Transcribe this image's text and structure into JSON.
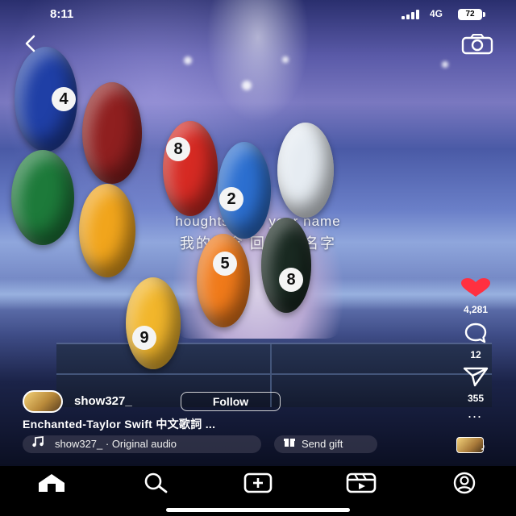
{
  "status_bar": {
    "time": "8:11",
    "network": "4G",
    "battery": "72"
  },
  "icons": {
    "back": "back-chevron-icon",
    "camera": "camera-icon",
    "like": "heart-icon",
    "comment": "comment-bubble-icon",
    "share": "send-icon",
    "more": "more-dots-icon",
    "audio": "music-note-icon",
    "gift": "gift-icon",
    "home": "home-icon",
    "search": "search-icon",
    "create": "create-plus-icon",
    "reels": "reels-icon",
    "profile": "profile-icon"
  },
  "video": {
    "lyric_en": "houghts    a  ho your name",
    "lyric_zh": "我的思念    回    你的名字"
  },
  "balls": [
    {
      "number": "4",
      "color": "#1f3fa6"
    },
    {
      "number": "",
      "color": "#8f1f1f"
    },
    {
      "number": "",
      "color": "#1d7a3a"
    },
    {
      "number": "",
      "color": "#f1a51c"
    },
    {
      "number": "8",
      "color": "#d62a23"
    },
    {
      "number": "2",
      "color": "#2c6fd0"
    },
    {
      "number": "",
      "color": "#e6ecf2"
    },
    {
      "number": "5",
      "color": "#f07a1a"
    },
    {
      "number": "8",
      "color": "#1a2a22"
    },
    {
      "number": "9",
      "color": "#f2b62b"
    }
  ],
  "actions": {
    "likes": "4,281",
    "comments": "12",
    "shares": "355",
    "more": "..."
  },
  "author": {
    "name": "show327_",
    "follow_label": "Follow"
  },
  "caption": "Enchanted-Taylor Swift 中文歌詞 ...",
  "audio": {
    "label": "show327_ · Original audio",
    "note": "♪"
  },
  "gift": {
    "label": "Send gift"
  },
  "colors": {
    "like_red": "#ff3040",
    "background": "#000000",
    "pill_bg": "#46465a"
  }
}
